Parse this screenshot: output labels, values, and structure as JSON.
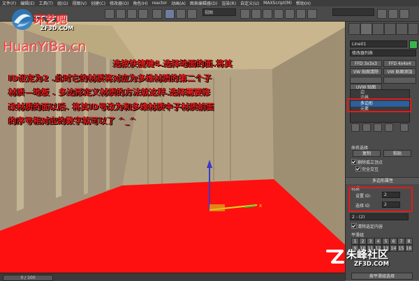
{
  "menu": [
    "文件(F)",
    "编辑(E)",
    "工具(T)",
    "组(G)",
    "视图(V)",
    "创建(C)",
    "修改器(O)",
    "角色(H)",
    "reactor",
    "动画(A)",
    "图表编辑器(D)",
    "渲染(R)",
    "自定义(U)",
    "MAXScript(M)",
    "帮助(H)"
  ],
  "toolbar": {
    "view_select": "视图"
  },
  "logo": {
    "chinese": "环艺吧",
    "url": "ZF3D.COM",
    "pinyin": "HuanYiBa.cn"
  },
  "viewport": {
    "instruction_lines": [
      "选按快捷键4.选择地面的面.将其",
      "ID设定为2 .此时它的材质将对应为多维材质的第二个子",
      "材质—地板 . 多边形定义材质的方法就这样.选择需要修",
      "改材质的面以后. 将其ID号改为和多维材质中子材质前面",
      "的序号相对应的数字就可以了 ^_^"
    ],
    "axis_x": "x"
  },
  "status": {
    "time": "0 / 100"
  },
  "panel": {
    "object_name": "Line01",
    "modifier_list": "修改器列表",
    "buttons_row1": [
      "FFD 3x3x3",
      "FFD 4x4x4"
    ],
    "buttons_row2": [
      "VW 贴图清除",
      "VW 贴图添加"
    ],
    "buttons_row3": [
      "",
      ""
    ],
    "buttons_row4": [
      "UVW 贴图",
      ""
    ],
    "stack_items": [
      "边",
      "边界",
      "多边形",
      "元素"
    ],
    "named_selection": "命名选择",
    "copy_label": "复制",
    "paste_label": "粘贴",
    "delete_isolated": "删除孤立顶点",
    "full_interactive": "完全交互",
    "polygon_props_title": "多边形属性",
    "material_label": "材质",
    "set_id_label": "设置 ID:",
    "set_id_value": "2",
    "select_id_label": "选择 ID",
    "select_id_value": "2",
    "sub_material": "2 - (2)",
    "clear_selection": "清除选定内容",
    "smoothing_group": "平滑组",
    "sg_numbers": [
      "1",
      "2",
      "3",
      "4",
      "5",
      "6",
      "7",
      "8",
      "9",
      "10",
      "11",
      "12",
      "13",
      "14",
      "15",
      "16"
    ],
    "select_by_sg": "按平滑组选择"
  },
  "watermark": {
    "chinese": "朱峰社区",
    "url": "ZF3D.COM"
  },
  "colors": {
    "red": "#ee1c1c",
    "floor": "#ff1010",
    "walls": "#a89876",
    "ceiling": "#c9b58e",
    "panel_bg": "#4b4b4b"
  }
}
